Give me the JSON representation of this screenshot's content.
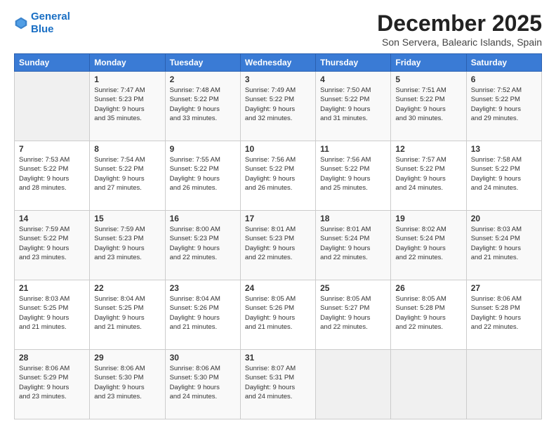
{
  "logo": {
    "line1": "General",
    "line2": "Blue"
  },
  "title": "December 2025",
  "location": "Son Servera, Balearic Islands, Spain",
  "days_header": [
    "Sunday",
    "Monday",
    "Tuesday",
    "Wednesday",
    "Thursday",
    "Friday",
    "Saturday"
  ],
  "weeks": [
    [
      {
        "day": "",
        "info": ""
      },
      {
        "day": "1",
        "info": "Sunrise: 7:47 AM\nSunset: 5:23 PM\nDaylight: 9 hours\nand 35 minutes."
      },
      {
        "day": "2",
        "info": "Sunrise: 7:48 AM\nSunset: 5:22 PM\nDaylight: 9 hours\nand 33 minutes."
      },
      {
        "day": "3",
        "info": "Sunrise: 7:49 AM\nSunset: 5:22 PM\nDaylight: 9 hours\nand 32 minutes."
      },
      {
        "day": "4",
        "info": "Sunrise: 7:50 AM\nSunset: 5:22 PM\nDaylight: 9 hours\nand 31 minutes."
      },
      {
        "day": "5",
        "info": "Sunrise: 7:51 AM\nSunset: 5:22 PM\nDaylight: 9 hours\nand 30 minutes."
      },
      {
        "day": "6",
        "info": "Sunrise: 7:52 AM\nSunset: 5:22 PM\nDaylight: 9 hours\nand 29 minutes."
      }
    ],
    [
      {
        "day": "7",
        "info": "Sunrise: 7:53 AM\nSunset: 5:22 PM\nDaylight: 9 hours\nand 28 minutes."
      },
      {
        "day": "8",
        "info": "Sunrise: 7:54 AM\nSunset: 5:22 PM\nDaylight: 9 hours\nand 27 minutes."
      },
      {
        "day": "9",
        "info": "Sunrise: 7:55 AM\nSunset: 5:22 PM\nDaylight: 9 hours\nand 26 minutes."
      },
      {
        "day": "10",
        "info": "Sunrise: 7:56 AM\nSunset: 5:22 PM\nDaylight: 9 hours\nand 26 minutes."
      },
      {
        "day": "11",
        "info": "Sunrise: 7:56 AM\nSunset: 5:22 PM\nDaylight: 9 hours\nand 25 minutes."
      },
      {
        "day": "12",
        "info": "Sunrise: 7:57 AM\nSunset: 5:22 PM\nDaylight: 9 hours\nand 24 minutes."
      },
      {
        "day": "13",
        "info": "Sunrise: 7:58 AM\nSunset: 5:22 PM\nDaylight: 9 hours\nand 24 minutes."
      }
    ],
    [
      {
        "day": "14",
        "info": "Sunrise: 7:59 AM\nSunset: 5:22 PM\nDaylight: 9 hours\nand 23 minutes."
      },
      {
        "day": "15",
        "info": "Sunrise: 7:59 AM\nSunset: 5:23 PM\nDaylight: 9 hours\nand 23 minutes."
      },
      {
        "day": "16",
        "info": "Sunrise: 8:00 AM\nSunset: 5:23 PM\nDaylight: 9 hours\nand 22 minutes."
      },
      {
        "day": "17",
        "info": "Sunrise: 8:01 AM\nSunset: 5:23 PM\nDaylight: 9 hours\nand 22 minutes."
      },
      {
        "day": "18",
        "info": "Sunrise: 8:01 AM\nSunset: 5:24 PM\nDaylight: 9 hours\nand 22 minutes."
      },
      {
        "day": "19",
        "info": "Sunrise: 8:02 AM\nSunset: 5:24 PM\nDaylight: 9 hours\nand 22 minutes."
      },
      {
        "day": "20",
        "info": "Sunrise: 8:03 AM\nSunset: 5:24 PM\nDaylight: 9 hours\nand 21 minutes."
      }
    ],
    [
      {
        "day": "21",
        "info": "Sunrise: 8:03 AM\nSunset: 5:25 PM\nDaylight: 9 hours\nand 21 minutes."
      },
      {
        "day": "22",
        "info": "Sunrise: 8:04 AM\nSunset: 5:25 PM\nDaylight: 9 hours\nand 21 minutes."
      },
      {
        "day": "23",
        "info": "Sunrise: 8:04 AM\nSunset: 5:26 PM\nDaylight: 9 hours\nand 21 minutes."
      },
      {
        "day": "24",
        "info": "Sunrise: 8:05 AM\nSunset: 5:26 PM\nDaylight: 9 hours\nand 21 minutes."
      },
      {
        "day": "25",
        "info": "Sunrise: 8:05 AM\nSunset: 5:27 PM\nDaylight: 9 hours\nand 22 minutes."
      },
      {
        "day": "26",
        "info": "Sunrise: 8:05 AM\nSunset: 5:28 PM\nDaylight: 9 hours\nand 22 minutes."
      },
      {
        "day": "27",
        "info": "Sunrise: 8:06 AM\nSunset: 5:28 PM\nDaylight: 9 hours\nand 22 minutes."
      }
    ],
    [
      {
        "day": "28",
        "info": "Sunrise: 8:06 AM\nSunset: 5:29 PM\nDaylight: 9 hours\nand 23 minutes."
      },
      {
        "day": "29",
        "info": "Sunrise: 8:06 AM\nSunset: 5:30 PM\nDaylight: 9 hours\nand 23 minutes."
      },
      {
        "day": "30",
        "info": "Sunrise: 8:06 AM\nSunset: 5:30 PM\nDaylight: 9 hours\nand 24 minutes."
      },
      {
        "day": "31",
        "info": "Sunrise: 8:07 AM\nSunset: 5:31 PM\nDaylight: 9 hours\nand 24 minutes."
      },
      {
        "day": "",
        "info": ""
      },
      {
        "day": "",
        "info": ""
      },
      {
        "day": "",
        "info": ""
      }
    ]
  ]
}
